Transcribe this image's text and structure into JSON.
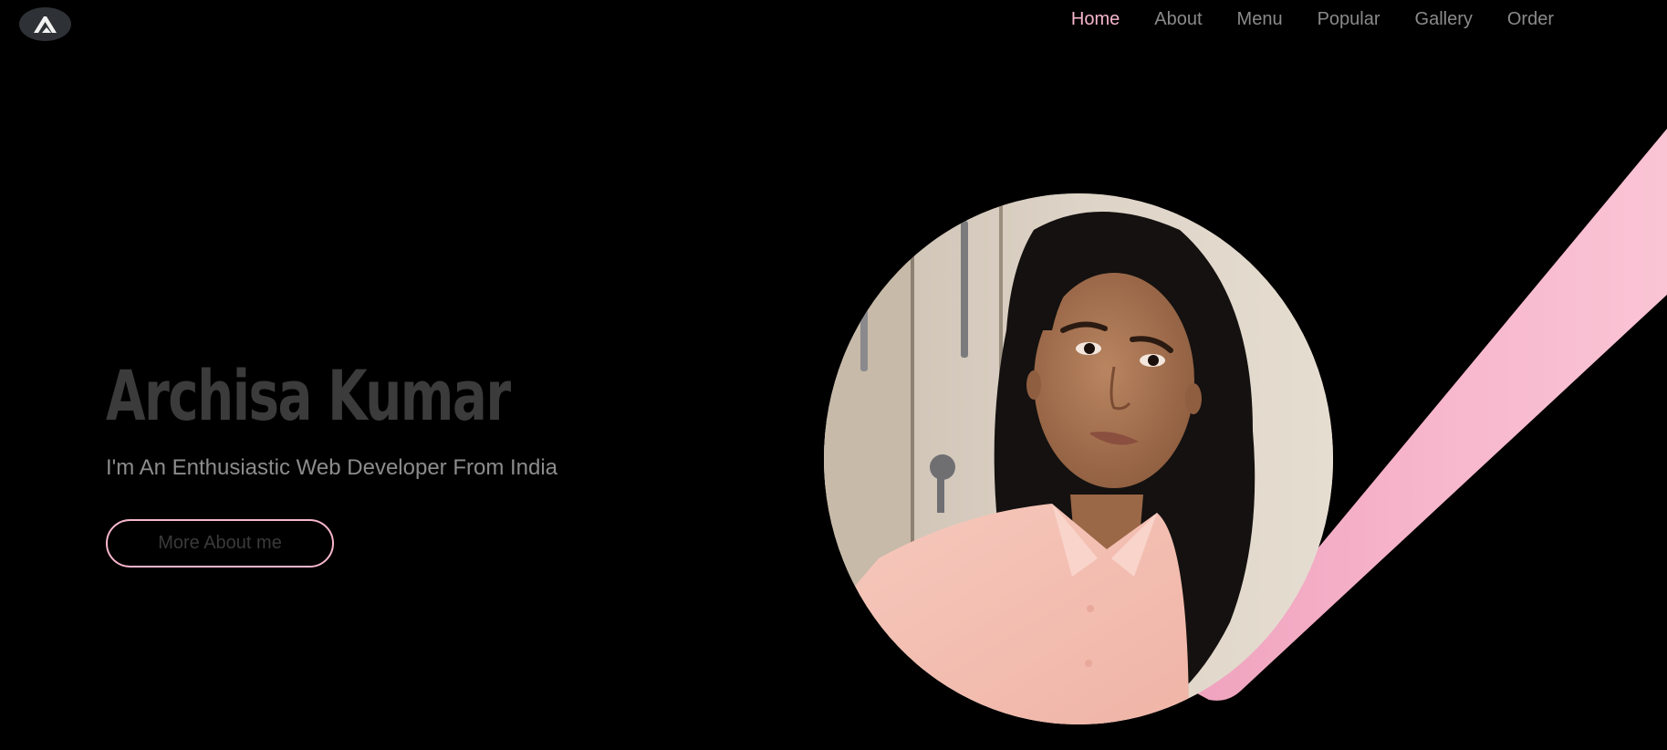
{
  "brand": {
    "logo_icon": "letter-a-logo-icon",
    "accent_color": "#f7b6cc"
  },
  "nav": {
    "items": [
      {
        "label": "Home",
        "active": true
      },
      {
        "label": "About",
        "active": false
      },
      {
        "label": "Menu",
        "active": false
      },
      {
        "label": "Popular",
        "active": false
      },
      {
        "label": "Gallery",
        "active": false
      },
      {
        "label": "Order",
        "active": false
      }
    ]
  },
  "hero": {
    "title": "Archisa Kumar",
    "subtitle": "I'm An Enthusiastic Web Developer From India",
    "cta_label": "More About me"
  },
  "portrait": {
    "alt": "profile-photo"
  }
}
